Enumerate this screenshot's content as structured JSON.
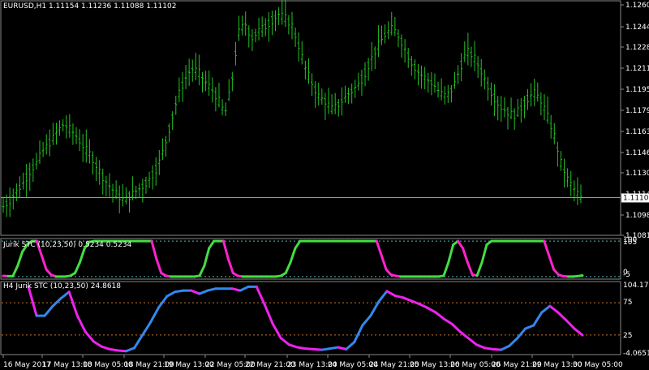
{
  "symbol_title": "EURUSD,H1  1.11154 1.11236 1.11088 1.11102",
  "current_price": "1.11102",
  "price_axis": [
    "1.12608",
    "1.12444",
    "1.12283",
    "1.12118",
    "1.11958",
    "1.11793",
    "1.11633",
    "1.11468",
    "1.11308",
    "1.11143",
    "1.10983",
    "1.10818"
  ],
  "stc_title": "Jurik STC (10,23,50) 0.5234 0.5234",
  "stc_axis": [
    "105",
    "-5"
  ],
  "stc_axis_overlap": [
    "100",
    "0"
  ],
  "h4_title": "H4 Jurik STC (10,23,50) 24.8618",
  "h4_axis": [
    "104.1727",
    "75",
    "25",
    "-4.0651"
  ],
  "date_axis": [
    "16 May 2017",
    "17 May 13:00",
    "18 May 05:00",
    "18 May 21:00",
    "19 May 13:00",
    "22 May 05:00",
    "22 May 21:00",
    "23 May 13:00",
    "24 May 05:00",
    "24 May 21:00",
    "25 May 13:00",
    "26 May 05:00",
    "26 May 21:00",
    "29 May 13:00",
    "30 May 05:00"
  ],
  "colors": {
    "candles": "#22c322",
    "stc_up": "#44dd44",
    "stc_down": "#ff22cc",
    "h4_up": "#3388ee",
    "h4_down": "#ee22ee",
    "level_lines": "#cc7722",
    "stc_level_lines": "#4fb3b3"
  },
  "chart_data": [
    {
      "type": "line",
      "panel": "price",
      "title": "EURUSD,H1",
      "ylim": [
        1.1081,
        1.1265
      ],
      "series": [
        {
          "name": "EURUSD H1 close (approx.)",
          "values": [
            1.1103,
            1.1108,
            1.1115,
            1.1122,
            1.1131,
            1.1138,
            1.1148,
            1.1154,
            1.1162,
            1.1168,
            1.1164,
            1.1158,
            1.115,
            1.1144,
            1.1134,
            1.1125,
            1.1118,
            1.1112,
            1.1108,
            1.1112,
            1.1116,
            1.112,
            1.1126,
            1.1135,
            1.115,
            1.117,
            1.119,
            1.1203,
            1.1212,
            1.121,
            1.1202,
            1.1196,
            1.1188,
            1.1176,
            1.12,
            1.124,
            1.1248,
            1.1236,
            1.1242,
            1.1245,
            1.125,
            1.1255,
            1.1252,
            1.1246,
            1.123,
            1.1212,
            1.12,
            1.119,
            1.1186,
            1.118,
            1.1184,
            1.119,
            1.1195,
            1.12,
            1.121,
            1.1222,
            1.1232,
            1.124,
            1.1244,
            1.1237,
            1.1225,
            1.1215,
            1.1208,
            1.1204,
            1.12,
            1.1193,
            1.119,
            1.1197,
            1.1212,
            1.1226,
            1.1222,
            1.1212,
            1.12,
            1.119,
            1.1182,
            1.1178,
            1.1175,
            1.118,
            1.1188,
            1.1193,
            1.1188,
            1.1175,
            1.116,
            1.1138,
            1.1125,
            1.1117,
            1.111
          ]
        }
      ]
    },
    {
      "type": "line",
      "panel": "stc",
      "title": "Jurik STC (10,23,50)",
      "ylim": [
        -5,
        105
      ],
      "series": [
        {
          "name": "Jurik STC (10,23,50)",
          "values": [
            2,
            1,
            1,
            30,
            70,
            90,
            100,
            100,
            60,
            20,
            5,
            0,
            0,
            0,
            2,
            10,
            40,
            80,
            98,
            100,
            100,
            100,
            100,
            100,
            100,
            100,
            100,
            100,
            100,
            100,
            100,
            100,
            50,
            10,
            2,
            0,
            0,
            0,
            0,
            0,
            0,
            2,
            30,
            80,
            100,
            100,
            100,
            50,
            10,
            2,
            0,
            0,
            0,
            0,
            0,
            0,
            0,
            0,
            2,
            10,
            40,
            80,
            100,
            100,
            100,
            100,
            100,
            100,
            100,
            100,
            100,
            100,
            100,
            100,
            100,
            100,
            100,
            100,
            100,
            60,
            20,
            5,
            2,
            0,
            0,
            0,
            0,
            0,
            0,
            0,
            0,
            0,
            2,
            40,
            90,
            100,
            80,
            40,
            5,
            3,
            40,
            90,
            100,
            100,
            100,
            100,
            100,
            100,
            100,
            100,
            100,
            100,
            100,
            100,
            60,
            20,
            5,
            1,
            0,
            0,
            1,
            3
          ]
        }
      ]
    },
    {
      "type": "line",
      "panel": "h4_stc",
      "title": "H4 Jurik STC (10,23,50)",
      "ylim": [
        -4.0651,
        104.1727
      ],
      "series": [
        {
          "name": "H4 Jurik STC (10,23,50)",
          "values": [
            100,
            55,
            55,
            70,
            82,
            92,
            55,
            30,
            15,
            7,
            3,
            1,
            0,
            5,
            25,
            45,
            68,
            85,
            92,
            94,
            94,
            89,
            94,
            97,
            97,
            97,
            94,
            100,
            100,
            72,
            42,
            20,
            10,
            6,
            4,
            3,
            2,
            4,
            6,
            3,
            14,
            40,
            55,
            77,
            93,
            86,
            83,
            78,
            73,
            67,
            60,
            50,
            42,
            30,
            20,
            10,
            5,
            3,
            2,
            8,
            20,
            35,
            40,
            60,
            70,
            60,
            48,
            35,
            24.86
          ]
        }
      ]
    }
  ]
}
